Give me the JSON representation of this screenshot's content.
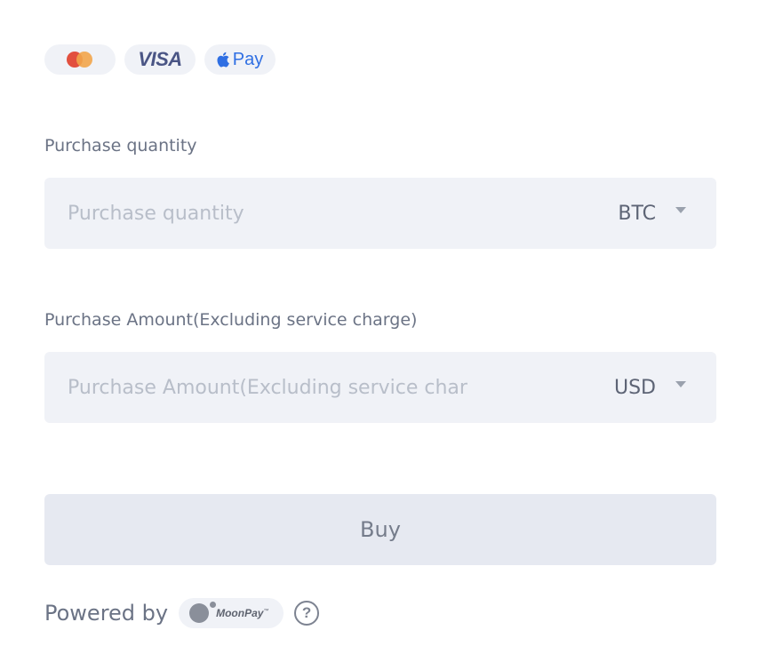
{
  "payment_methods": {
    "mastercard": {
      "icon": "mastercard-logo",
      "colors": [
        "#e2503f",
        "#f2a54a"
      ]
    },
    "visa": {
      "label": "VISA"
    },
    "applepay": {
      "label": "Pay",
      "icon": "apple-logo"
    }
  },
  "quantity": {
    "label": "Purchase quantity",
    "placeholder": "Purchase quantity",
    "value": "",
    "currency": "BTC"
  },
  "amount": {
    "label": "Purchase Amount(Excluding service charge)",
    "placeholder": "Purchase Amount(Excluding service charge)",
    "value": "",
    "currency": "USD"
  },
  "buy": {
    "label": "Buy"
  },
  "footer": {
    "powered_by": "Powered by",
    "provider": "MoonPay",
    "trademark": "™",
    "help_glyph": "?"
  }
}
